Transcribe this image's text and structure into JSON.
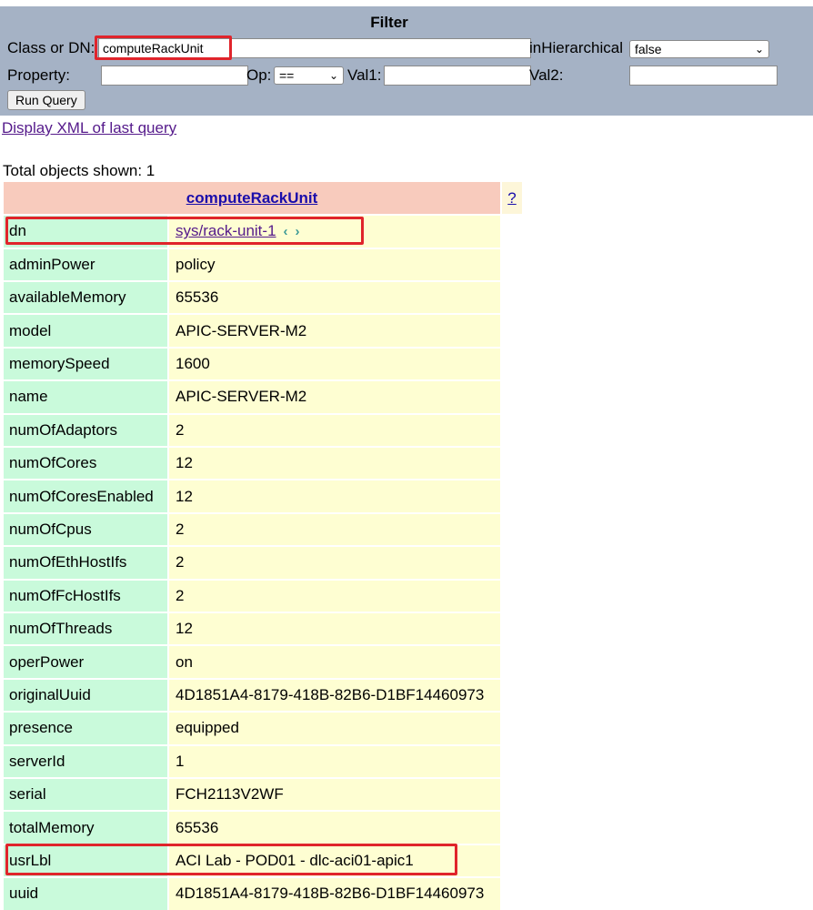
{
  "filter": {
    "title": "Filter",
    "class_label": "Class or DN:",
    "class_value": "computeRackUnit",
    "inhier_label": "inHierarchical",
    "inhier_value": "false",
    "property_label": "Property:",
    "property_value": "",
    "op_label": "Op:",
    "op_value": "==",
    "val1_label": "Val1:",
    "val1_value": "",
    "val2_label": "Val2:",
    "val2_value": "",
    "run_label": "Run Query"
  },
  "xml_link": "Display XML of last query",
  "total": "Total objects shown: 1",
  "object": {
    "class": "computeRackUnit",
    "help": "?",
    "dn_key": "dn",
    "dn_value": "sys/rack-unit-1",
    "rows": [
      {
        "key": "adminPower",
        "value": "policy"
      },
      {
        "key": "availableMemory",
        "value": "65536"
      },
      {
        "key": "model",
        "value": "APIC-SERVER-M2"
      },
      {
        "key": "memorySpeed",
        "value": "1600"
      },
      {
        "key": "name",
        "value": "APIC-SERVER-M2"
      },
      {
        "key": "numOfAdaptors",
        "value": "2"
      },
      {
        "key": "numOfCores",
        "value": "12"
      },
      {
        "key": "numOfCoresEnabled",
        "value": "12"
      },
      {
        "key": "numOfCpus",
        "value": "2"
      },
      {
        "key": "numOfEthHostIfs",
        "value": "2"
      },
      {
        "key": "numOfFcHostIfs",
        "value": "2"
      },
      {
        "key": "numOfThreads",
        "value": "12"
      },
      {
        "key": "operPower",
        "value": "on"
      },
      {
        "key": "originalUuid",
        "value": "4D1851A4-8179-418B-82B6-D1BF14460973"
      },
      {
        "key": "presence",
        "value": "equipped"
      },
      {
        "key": "serverId",
        "value": "1"
      },
      {
        "key": "serial",
        "value": "FCH2113V2WF"
      },
      {
        "key": "totalMemory",
        "value": "65536"
      },
      {
        "key": "usrLbl",
        "value": "ACI Lab - POD01 - dlc-aci01-apic1"
      },
      {
        "key": "uuid",
        "value": "4D1851A4-8179-418B-82B6-D1BF14460973"
      }
    ]
  }
}
